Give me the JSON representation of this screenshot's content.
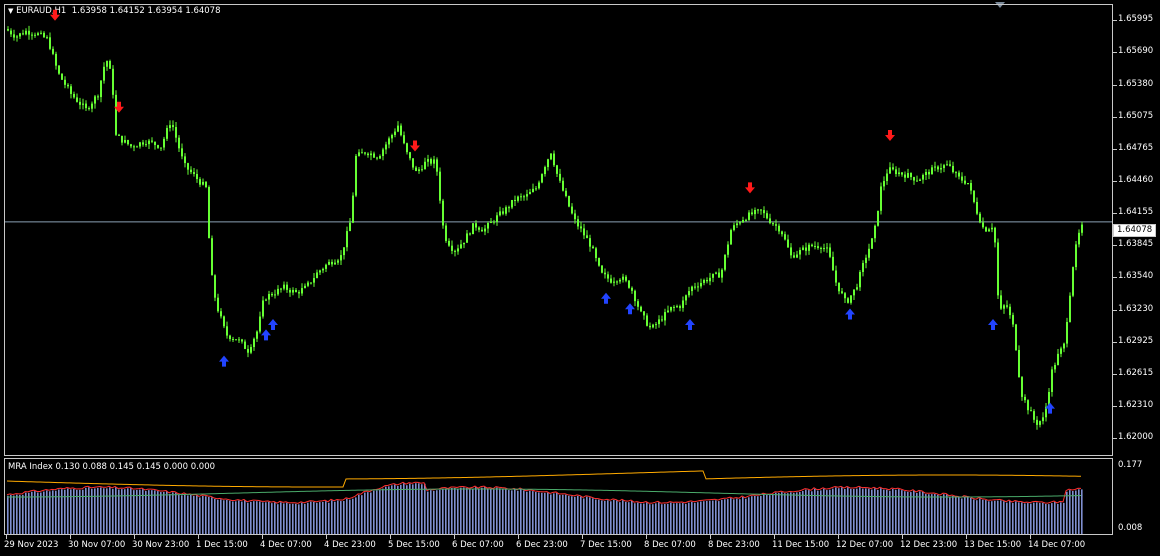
{
  "header": {
    "menu_icon": "triangle-down-icon",
    "symbol": "EURAUD,H1",
    "open": "1.63958",
    "high": "1.64152",
    "low": "1.63954",
    "close": "1.64078"
  },
  "current_price": "1.64078",
  "colors": {
    "background": "#000000",
    "candle": "#66ff33",
    "sell_arrow": "#ff1a1a",
    "buy_arrow": "#2244ff",
    "grid_border": "#c8c8c8",
    "price_line": "#8aa0b4",
    "histogram": "#8090d0",
    "ind_red": "#ff3030",
    "ind_orange": "#ffaa00",
    "ind_green": "#4aaa6a"
  },
  "price_axis": [
    "1.65995",
    "1.65690",
    "1.65380",
    "1.65075",
    "1.64765",
    "1.64460",
    "1.64155",
    "1.63845",
    "1.63540",
    "1.63230",
    "1.62925",
    "1.62615",
    "1.62310",
    "1.62000"
  ],
  "time_axis": [
    "29 Nov 2023",
    "30 Nov 07:00",
    "30 Nov 23:00",
    "1 Dec 15:00",
    "4 Dec 07:00",
    "4 Dec 23:00",
    "5 Dec 15:00",
    "6 Dec 07:00",
    "6 Dec 23:00",
    "7 Dec 15:00",
    "8 Dec 07:00",
    "8 Dec 23:00",
    "11 Dec 15:00",
    "12 Dec 07:00",
    "12 Dec 23:00",
    "13 Dec 15:00",
    "14 Dec 07:00"
  ],
  "indicator": {
    "label": "MRA Index 0.130 0.088 0.145 0.145 0.000 0.000",
    "max": "0.177",
    "min": "0.008"
  },
  "chart_data": {
    "type": "candlestick",
    "price_range": [
      1.6185,
      1.6615
    ],
    "close_path": [
      [
        0,
        1.6592
      ],
      [
        10,
        1.6585
      ],
      [
        20,
        1.659
      ],
      [
        30,
        1.6588
      ],
      [
        42,
        1.6582
      ],
      [
        52,
        1.655
      ],
      [
        65,
        1.653
      ],
      [
        80,
        1.6515
      ],
      [
        92,
        1.653
      ],
      [
        100,
        1.6565
      ],
      [
        106,
        1.6545
      ],
      [
        110,
        1.649
      ],
      [
        125,
        1.648
      ],
      [
        140,
        1.6485
      ],
      [
        155,
        1.648
      ],
      [
        165,
        1.6505
      ],
      [
        178,
        1.6462
      ],
      [
        190,
        1.645
      ],
      [
        200,
        1.644
      ],
      [
        205,
        1.636
      ],
      [
        210,
        1.633
      ],
      [
        220,
        1.63
      ],
      [
        232,
        1.6295
      ],
      [
        242,
        1.6285
      ],
      [
        252,
        1.6305
      ],
      [
        258,
        1.6335
      ],
      [
        268,
        1.634
      ],
      [
        278,
        1.6345
      ],
      [
        290,
        1.634
      ],
      [
        300,
        1.6345
      ],
      [
        312,
        1.636
      ],
      [
        322,
        1.6368
      ],
      [
        335,
        1.6375
      ],
      [
        345,
        1.641
      ],
      [
        350,
        1.647
      ],
      [
        360,
        1.6475
      ],
      [
        372,
        1.647
      ],
      [
        382,
        1.6485
      ],
      [
        392,
        1.65
      ],
      [
        400,
        1.6475
      ],
      [
        410,
        1.6455
      ],
      [
        420,
        1.6465
      ],
      [
        430,
        1.6465
      ],
      [
        438,
        1.6395
      ],
      [
        448,
        1.638
      ],
      [
        458,
        1.639
      ],
      [
        468,
        1.6405
      ],
      [
        478,
        1.64
      ],
      [
        488,
        1.641
      ],
      [
        500,
        1.642
      ],
      [
        510,
        1.643
      ],
      [
        520,
        1.6432
      ],
      [
        530,
        1.644
      ],
      [
        538,
        1.646
      ],
      [
        545,
        1.6475
      ],
      [
        552,
        1.645
      ],
      [
        560,
        1.643
      ],
      [
        568,
        1.641
      ],
      [
        575,
        1.64
      ],
      [
        585,
        1.6385
      ],
      [
        595,
        1.6358
      ],
      [
        605,
        1.6352
      ],
      [
        615,
        1.6355
      ],
      [
        625,
        1.6345
      ],
      [
        635,
        1.632
      ],
      [
        645,
        1.6305
      ],
      [
        655,
        1.6315
      ],
      [
        665,
        1.6325
      ],
      [
        675,
        1.6328
      ],
      [
        685,
        1.6345
      ],
      [
        695,
        1.635
      ],
      [
        705,
        1.6355
      ],
      [
        715,
        1.6358
      ],
      [
        725,
        1.64
      ],
      [
        735,
        1.641
      ],
      [
        745,
        1.6415
      ],
      [
        755,
        1.6418
      ],
      [
        765,
        1.6408
      ],
      [
        775,
        1.64
      ],
      [
        785,
        1.6375
      ],
      [
        795,
        1.638
      ],
      [
        805,
        1.6385
      ],
      [
        815,
        1.6385
      ],
      [
        822,
        1.638
      ],
      [
        830,
        1.635
      ],
      [
        840,
        1.633
      ],
      [
        850,
        1.6345
      ],
      [
        860,
        1.6375
      ],
      [
        868,
        1.6395
      ],
      [
        875,
        1.644
      ],
      [
        882,
        1.6458
      ],
      [
        892,
        1.6455
      ],
      [
        902,
        1.6452
      ],
      [
        912,
        1.6448
      ],
      [
        922,
        1.6455
      ],
      [
        932,
        1.646
      ],
      [
        942,
        1.6462
      ],
      [
        952,
        1.645
      ],
      [
        962,
        1.6445
      ],
      [
        970,
        1.642
      ],
      [
        978,
        1.64
      ],
      [
        988,
        1.6405
      ],
      [
        993,
        1.632
      ],
      [
        1000,
        1.633
      ],
      [
        1008,
        1.6305
      ],
      [
        1015,
        1.6245
      ],
      [
        1022,
        1.623
      ],
      [
        1030,
        1.6215
      ],
      [
        1038,
        1.622
      ],
      [
        1046,
        1.6265
      ],
      [
        1052,
        1.628
      ],
      [
        1058,
        1.629
      ],
      [
        1064,
        1.634
      ],
      [
        1068,
        1.6375
      ],
      [
        1074,
        1.64
      ],
      [
        1080,
        1.6408
      ]
    ],
    "sell_signals_x": [
      50,
      114,
      410,
      745,
      885
    ],
    "buy_signals_x": [
      219,
      261,
      268,
      601,
      625,
      685,
      845,
      988,
      1045
    ],
    "buy_signal_prices": [
      1.628,
      1.6305,
      1.6315,
      1.634,
      1.633,
      1.6315,
      1.6325,
      1.6315,
      1.6235
    ],
    "sell_signal_prices": [
      1.66,
      1.6512,
      1.6475,
      1.6435,
      1.6485
    ]
  }
}
